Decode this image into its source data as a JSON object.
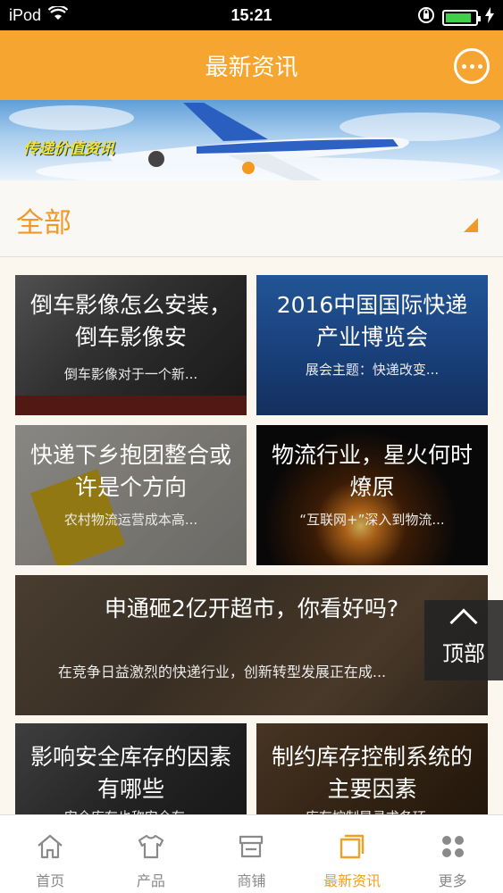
{
  "status_bar": {
    "carrier": "iPod",
    "time": "15:21"
  },
  "header": {
    "title": "最新资讯"
  },
  "banner": {
    "text": "传递价值资讯"
  },
  "category": {
    "label": "全部"
  },
  "articles": [
    {
      "title": "倒车影像怎么安装，倒车影像安",
      "summary": "倒车影像对于一个新..."
    },
    {
      "title": "2016中国国际快递产业博览会",
      "summary": "展会主题：快递改变..."
    },
    {
      "title": "快递下乡抱团整合或许是个方向",
      "summary": "农村物流运营成本高..."
    },
    {
      "title": "物流行业，星火何时燎原",
      "summary": "“互联网+”深入到物流..."
    },
    {
      "title": "申通砸2亿开超市，你看好吗?",
      "summary": "在竞争日益激烈的快递行业，创新转型发展正在成..."
    },
    {
      "title": "影响安全库存的因素有哪些",
      "summary": "安全库存也称安全存..."
    },
    {
      "title": "制约库存控制系统的主要因素",
      "summary": "库存控制是寻求各环..."
    }
  ],
  "back_to_top": {
    "label": "顶部"
  },
  "tabs": [
    {
      "label": "首页",
      "icon": "home-icon",
      "active": false
    },
    {
      "label": "产品",
      "icon": "shirt-icon",
      "active": false
    },
    {
      "label": "商铺",
      "icon": "shop-icon",
      "active": false
    },
    {
      "label": "最新资讯",
      "icon": "news-icon",
      "active": true
    },
    {
      "label": "更多",
      "icon": "more-icon",
      "active": false
    }
  ],
  "colors": {
    "accent": "#f7a531",
    "active_tab": "#f0a024",
    "background": "#fbf6ee"
  }
}
